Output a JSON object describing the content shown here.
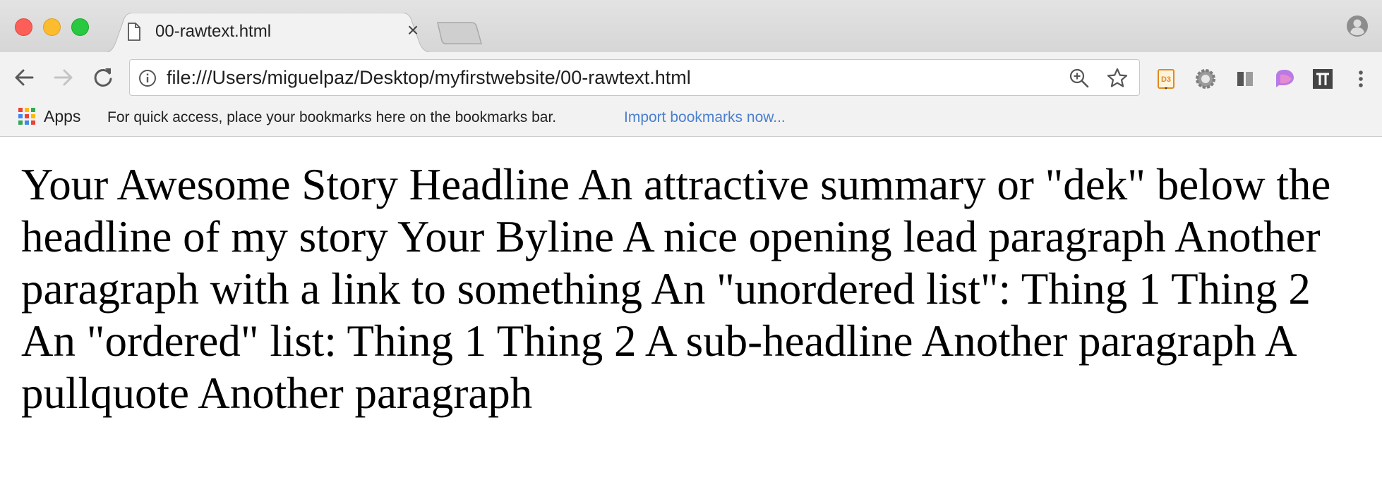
{
  "tab": {
    "title": "00-rawtext.html",
    "close": "×"
  },
  "address_bar": {
    "url": "file:///Users/miguelpaz/Desktop/myfirstwebsite/00-rawtext.html"
  },
  "bookmarks_bar": {
    "apps_label": "Apps",
    "hint": "For quick access, place your bookmarks here on the bookmarks bar.",
    "import_link": "Import bookmarks now..."
  },
  "extensions": [
    "d3-icon",
    "gear-icon",
    "panel-icon",
    "feather-icon",
    "pi-icon"
  ],
  "page": {
    "text": "Your Awesome Story Headline An attractive summary or \"dek\" below the headline of my story Your Byline A nice opening lead paragraph Another paragraph with a link to something An \"unordered list\": Thing 1 Thing 2 An \"ordered\" list: Thing 1 Thing 2 A sub-headline Another paragraph A pullquote Another paragraph"
  },
  "colors": {
    "close": "#fc5f57",
    "minimize": "#fdbc2e",
    "maximize": "#28c840",
    "link": "#4a7fd0"
  }
}
